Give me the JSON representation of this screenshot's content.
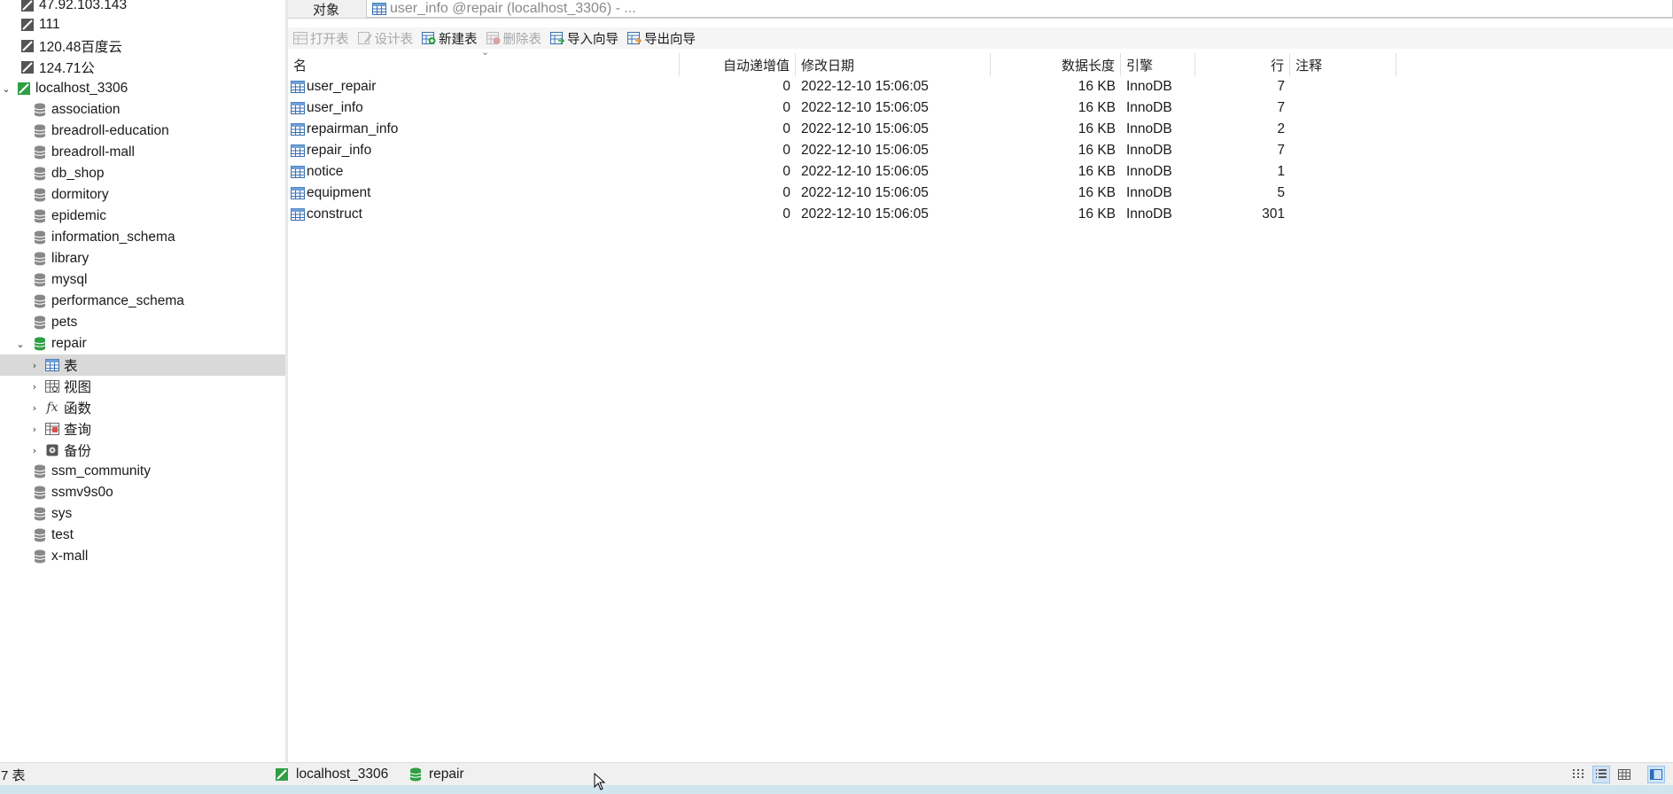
{
  "sidebar": {
    "items": [
      {
        "label": "47.92.103.143",
        "icon": "server-connection-icon"
      },
      {
        "label": "111",
        "icon": "server-connection-icon"
      },
      {
        "label": "120.48百度云",
        "icon": "server-connection-icon"
      },
      {
        "label": "124.71公",
        "icon": "server-connection-icon"
      },
      {
        "label": "localhost_3306",
        "icon": "mysql-connection-icon"
      },
      {
        "label": "association",
        "icon": "database-icon"
      },
      {
        "label": "breadroll-education",
        "icon": "database-icon"
      },
      {
        "label": "breadroll-mall",
        "icon": "database-icon"
      },
      {
        "label": "db_shop",
        "icon": "database-icon"
      },
      {
        "label": "dormitory",
        "icon": "database-icon"
      },
      {
        "label": "epidemic",
        "icon": "database-icon"
      },
      {
        "label": "information_schema",
        "icon": "database-icon"
      },
      {
        "label": "library",
        "icon": "database-icon"
      },
      {
        "label": "mysql",
        "icon": "database-icon"
      },
      {
        "label": "performance_schema",
        "icon": "database-icon"
      },
      {
        "label": "pets",
        "icon": "database-icon"
      },
      {
        "label": "repair",
        "icon": "database-open-icon"
      },
      {
        "label": "表",
        "icon": "tables-icon"
      },
      {
        "label": "视图",
        "icon": "views-icon"
      },
      {
        "label": "函数",
        "icon": "function-icon"
      },
      {
        "label": "查询",
        "icon": "query-icon"
      },
      {
        "label": "备份",
        "icon": "backup-icon"
      },
      {
        "label": "ssm_community",
        "icon": "database-icon"
      },
      {
        "label": "ssmv9s0o",
        "icon": "database-icon"
      },
      {
        "label": "sys",
        "icon": "database-icon"
      },
      {
        "label": "test",
        "icon": "database-icon"
      },
      {
        "label": "x-mall",
        "icon": "database-icon"
      }
    ],
    "selected": "表"
  },
  "tabs": {
    "objects": "对象",
    "editor": "user_info @repair (localhost_3306) - ..."
  },
  "toolbar": {
    "open_table": "打开表",
    "design_table": "设计表",
    "new_table": "新建表",
    "delete_table": "删除表",
    "import_wizard": "导入向导",
    "export_wizard": "导出向导"
  },
  "table": {
    "columns": {
      "name": "名",
      "auto_inc": "自动递增值",
      "modified": "修改日期",
      "data_length": "数据长度",
      "engine": "引擎",
      "rows": "行",
      "comment": "注释"
    },
    "rows": [
      {
        "name": "user_repair",
        "auto_inc": "0",
        "modified": "2022-12-10 15:06:05",
        "data_length": "16 KB",
        "engine": "InnoDB",
        "rows": "7",
        "comment": ""
      },
      {
        "name": "user_info",
        "auto_inc": "0",
        "modified": "2022-12-10 15:06:05",
        "data_length": "16 KB",
        "engine": "InnoDB",
        "rows": "7",
        "comment": ""
      },
      {
        "name": "repairman_info",
        "auto_inc": "0",
        "modified": "2022-12-10 15:06:05",
        "data_length": "16 KB",
        "engine": "InnoDB",
        "rows": "2",
        "comment": ""
      },
      {
        "name": "repair_info",
        "auto_inc": "0",
        "modified": "2022-12-10 15:06:05",
        "data_length": "16 KB",
        "engine": "InnoDB",
        "rows": "7",
        "comment": ""
      },
      {
        "name": "notice",
        "auto_inc": "0",
        "modified": "2022-12-10 15:06:05",
        "data_length": "16 KB",
        "engine": "InnoDB",
        "rows": "1",
        "comment": ""
      },
      {
        "name": "equipment",
        "auto_inc": "0",
        "modified": "2022-12-10 15:06:05",
        "data_length": "16 KB",
        "engine": "InnoDB",
        "rows": "5",
        "comment": ""
      },
      {
        "name": "construct",
        "auto_inc": "0",
        "modified": "2022-12-10 15:06:05",
        "data_length": "16 KB",
        "engine": "InnoDB",
        "rows": "301",
        "comment": ""
      }
    ]
  },
  "status": {
    "count": "7 表",
    "connection": "localhost_3306",
    "database": "repair"
  },
  "colors": {
    "selected_row": "#d9d9d9",
    "db_green": "#2f9e44",
    "disabled_text": "#a8a8a8"
  }
}
